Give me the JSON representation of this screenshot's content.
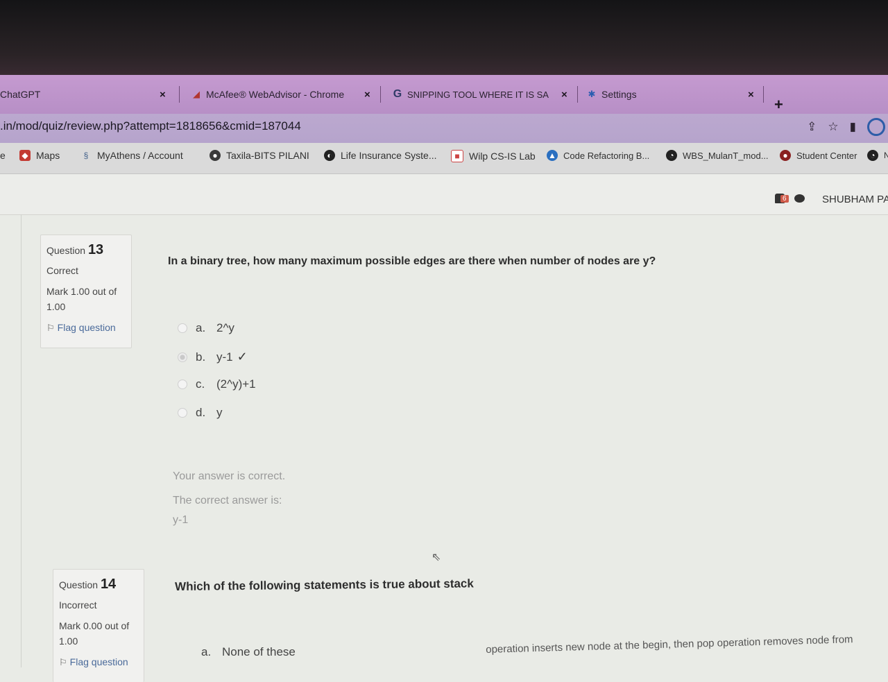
{
  "tabs": [
    {
      "label": "ChatGPT",
      "close": "×"
    },
    {
      "label": "McAfee® WebAdvisor - Chrome",
      "close": "×"
    },
    {
      "label": "SNIPPING TOOL WHERE IT IS SA",
      "close": "×"
    },
    {
      "label": "Settings",
      "close": "×"
    }
  ],
  "new_tab": "+",
  "address": {
    "url": ".in/mod/quiz/review.php?attempt=1818656&cmid=187044"
  },
  "bookmarks": [
    {
      "label": "e"
    },
    {
      "label": "Maps"
    },
    {
      "label": "MyAthens / Account"
    },
    {
      "label": "Taxila-BITS PILANI"
    },
    {
      "label": "Life Insurance Syste..."
    },
    {
      "label": "Wilp CS-IS Lab"
    },
    {
      "label": "Code Refactoring B..."
    },
    {
      "label": "WBS_MulanT_mod..."
    },
    {
      "label": "Student Center"
    },
    {
      "label": "N"
    }
  ],
  "header": {
    "notification_count": "6",
    "user_name": "SHUBHAM PA"
  },
  "questions": [
    {
      "label": "Question",
      "number": "13",
      "status": "Correct",
      "mark_line1": "Mark 1.00 out of",
      "mark_line2": "1.00",
      "flag": "Flag question",
      "text": "In a binary tree, how many maximum possible edges are there when number of nodes are y?",
      "options": [
        {
          "letter": "a.",
          "text": "2^y"
        },
        {
          "letter": "b.",
          "text": "y-1",
          "selected": true
        },
        {
          "letter": "c.",
          "text": "(2^y)+1"
        },
        {
          "letter": "d.",
          "text": "y"
        }
      ],
      "feedback_correct": "Your answer is correct.",
      "feedback_label": "The correct answer is:",
      "feedback_answer": "y-1"
    },
    {
      "label": "Question",
      "number": "14",
      "status": "Incorrect",
      "mark_line1": "Mark 0.00 out of",
      "mark_line2": "1.00",
      "flag": "Flag question",
      "text": "Which of the following statements is true about stack",
      "options": [
        {
          "letter": "a.",
          "text": "None of these"
        }
      ],
      "trailing_text": "operation inserts new node at the begin, then pop operation removes node from"
    }
  ]
}
